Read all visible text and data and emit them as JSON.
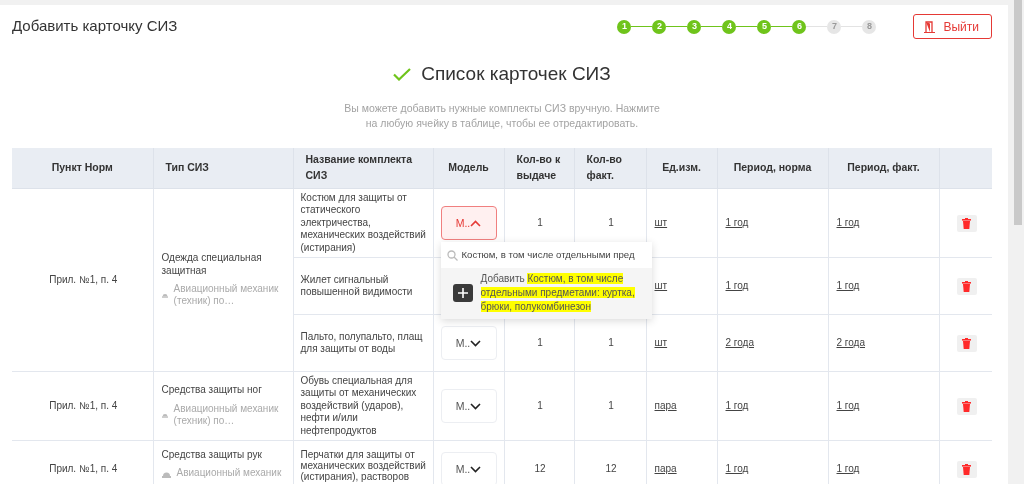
{
  "title": "Добавить карточку СИЗ",
  "steps": [
    {
      "label": "1",
      "done": true
    },
    {
      "label": "2",
      "done": true
    },
    {
      "label": "3",
      "done": true
    },
    {
      "label": "4",
      "done": true
    },
    {
      "label": "5",
      "done": true
    },
    {
      "label": "6",
      "done": true
    },
    {
      "label": "7",
      "done": false
    },
    {
      "label": "8",
      "done": false
    }
  ],
  "exit_button": "Выйти",
  "heading": "Список карточек СИЗ",
  "description": "Вы можете добавить нужные комплекты СИЗ вручную. Нажмите на любую ячейку в таблице, чтобы ее отредактировать.",
  "table": {
    "columns": [
      "Пункт Норм",
      "Тип СИЗ",
      "Название комплекта СИЗ",
      "Модель",
      "Кол-во к выдаче",
      "Кол-во факт.",
      "Ед.изм.",
      "Период, норма",
      "Период, факт."
    ],
    "groups": [
      {
        "clause": "Прил. №1, п. 4",
        "type": "Одежда специальная защитная",
        "profession": "Авиационный механик (техник) по…",
        "items": [
          {
            "name": "Костюм для защиты от статического электричества, механических воздействий (истирания)",
            "model": "М..",
            "expanded": true,
            "qty": "1",
            "fact": "1",
            "unit": "шт",
            "period_norm": "1 год",
            "period_fact": "1 год",
            "dropdown": {
              "search_value": "Костюм, в том числе отдельными пред",
              "add_label": "Добавить",
              "add_value": "Костюм, в том числе отдельными предметами: куртка, брюки, полукомбинезон"
            }
          },
          {
            "name": "Жилет сигнальный повышенной видимости",
            "unit": "шт",
            "period_norm": "1 год",
            "period_fact": "1 год"
          },
          {
            "name": "Пальто, полупальто, плащ для защиты от воды",
            "model": "М..",
            "expanded": false,
            "qty": "1",
            "fact": "1",
            "unit": "шт",
            "period_norm": "2 года",
            "period_fact": "2 года"
          }
        ]
      },
      {
        "clause": "Прил. №1, п. 4",
        "type": "Средства защиты ног",
        "profession": "Авиационный механик (техник) по…",
        "items": [
          {
            "name": "Обувь специальная для защиты от механических воздействий (ударов), нефти и/или нефтепродуктов",
            "model": "М..",
            "expanded": false,
            "qty": "1",
            "fact": "1",
            "unit": "пара",
            "period_norm": "1 год",
            "period_fact": "1 год"
          }
        ]
      },
      {
        "clause": "Прил. №1, п. 4",
        "type": "Средства защиты рук",
        "profession": "Авиационный механик",
        "items": [
          {
            "name": "Перчатки для защиты от механических воздействий (истирания), растворов",
            "model": "М..",
            "expanded": false,
            "qty": "12",
            "fact": "12",
            "unit": "пара",
            "period_norm": "1 год",
            "period_fact": "1 год"
          }
        ]
      }
    ]
  }
}
